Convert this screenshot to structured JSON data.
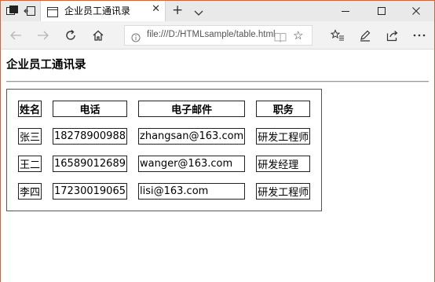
{
  "tab": {
    "title": "企业员工通讯录"
  },
  "address_bar": {
    "url": "file:///D:/HTMLsample/table.html"
  },
  "page": {
    "title": "企业员工通讯录"
  },
  "table": {
    "headers": [
      "姓名",
      "电话",
      "电子邮件",
      "职务"
    ],
    "rows": [
      [
        "张三",
        "18278900988",
        "zhangsan@163.com",
        "研发工程师"
      ],
      [
        "王二",
        "16589012689",
        "wanger@163.com",
        "研发经理"
      ],
      [
        "李四",
        "17230019065",
        "lisi@163.com",
        "研发工程师"
      ]
    ]
  },
  "icons": {
    "tab_actions": "tab-actions-icon",
    "set_aside": "set-aside-tabs-icon",
    "page": "page-icon",
    "close_tab": "close-icon",
    "new_tab": "plus-icon",
    "tab_menu": "chevron-down-icon",
    "minimize": "minimize-icon",
    "maximize": "maximize-icon",
    "close_window": "close-icon",
    "back": "back-arrow-icon",
    "forward": "forward-arrow-icon",
    "refresh": "refresh-icon",
    "home": "home-icon",
    "info": "info-icon",
    "reading_view": "book-icon",
    "favorite": "star-icon",
    "favorites": "favorites-icon",
    "notes": "pen-icon",
    "share": "share-icon",
    "more": "more-icon"
  },
  "colors": {
    "window_border": "#c9683a",
    "titlebar": "#e9e9e9",
    "navbar": "#f2f2f2"
  }
}
